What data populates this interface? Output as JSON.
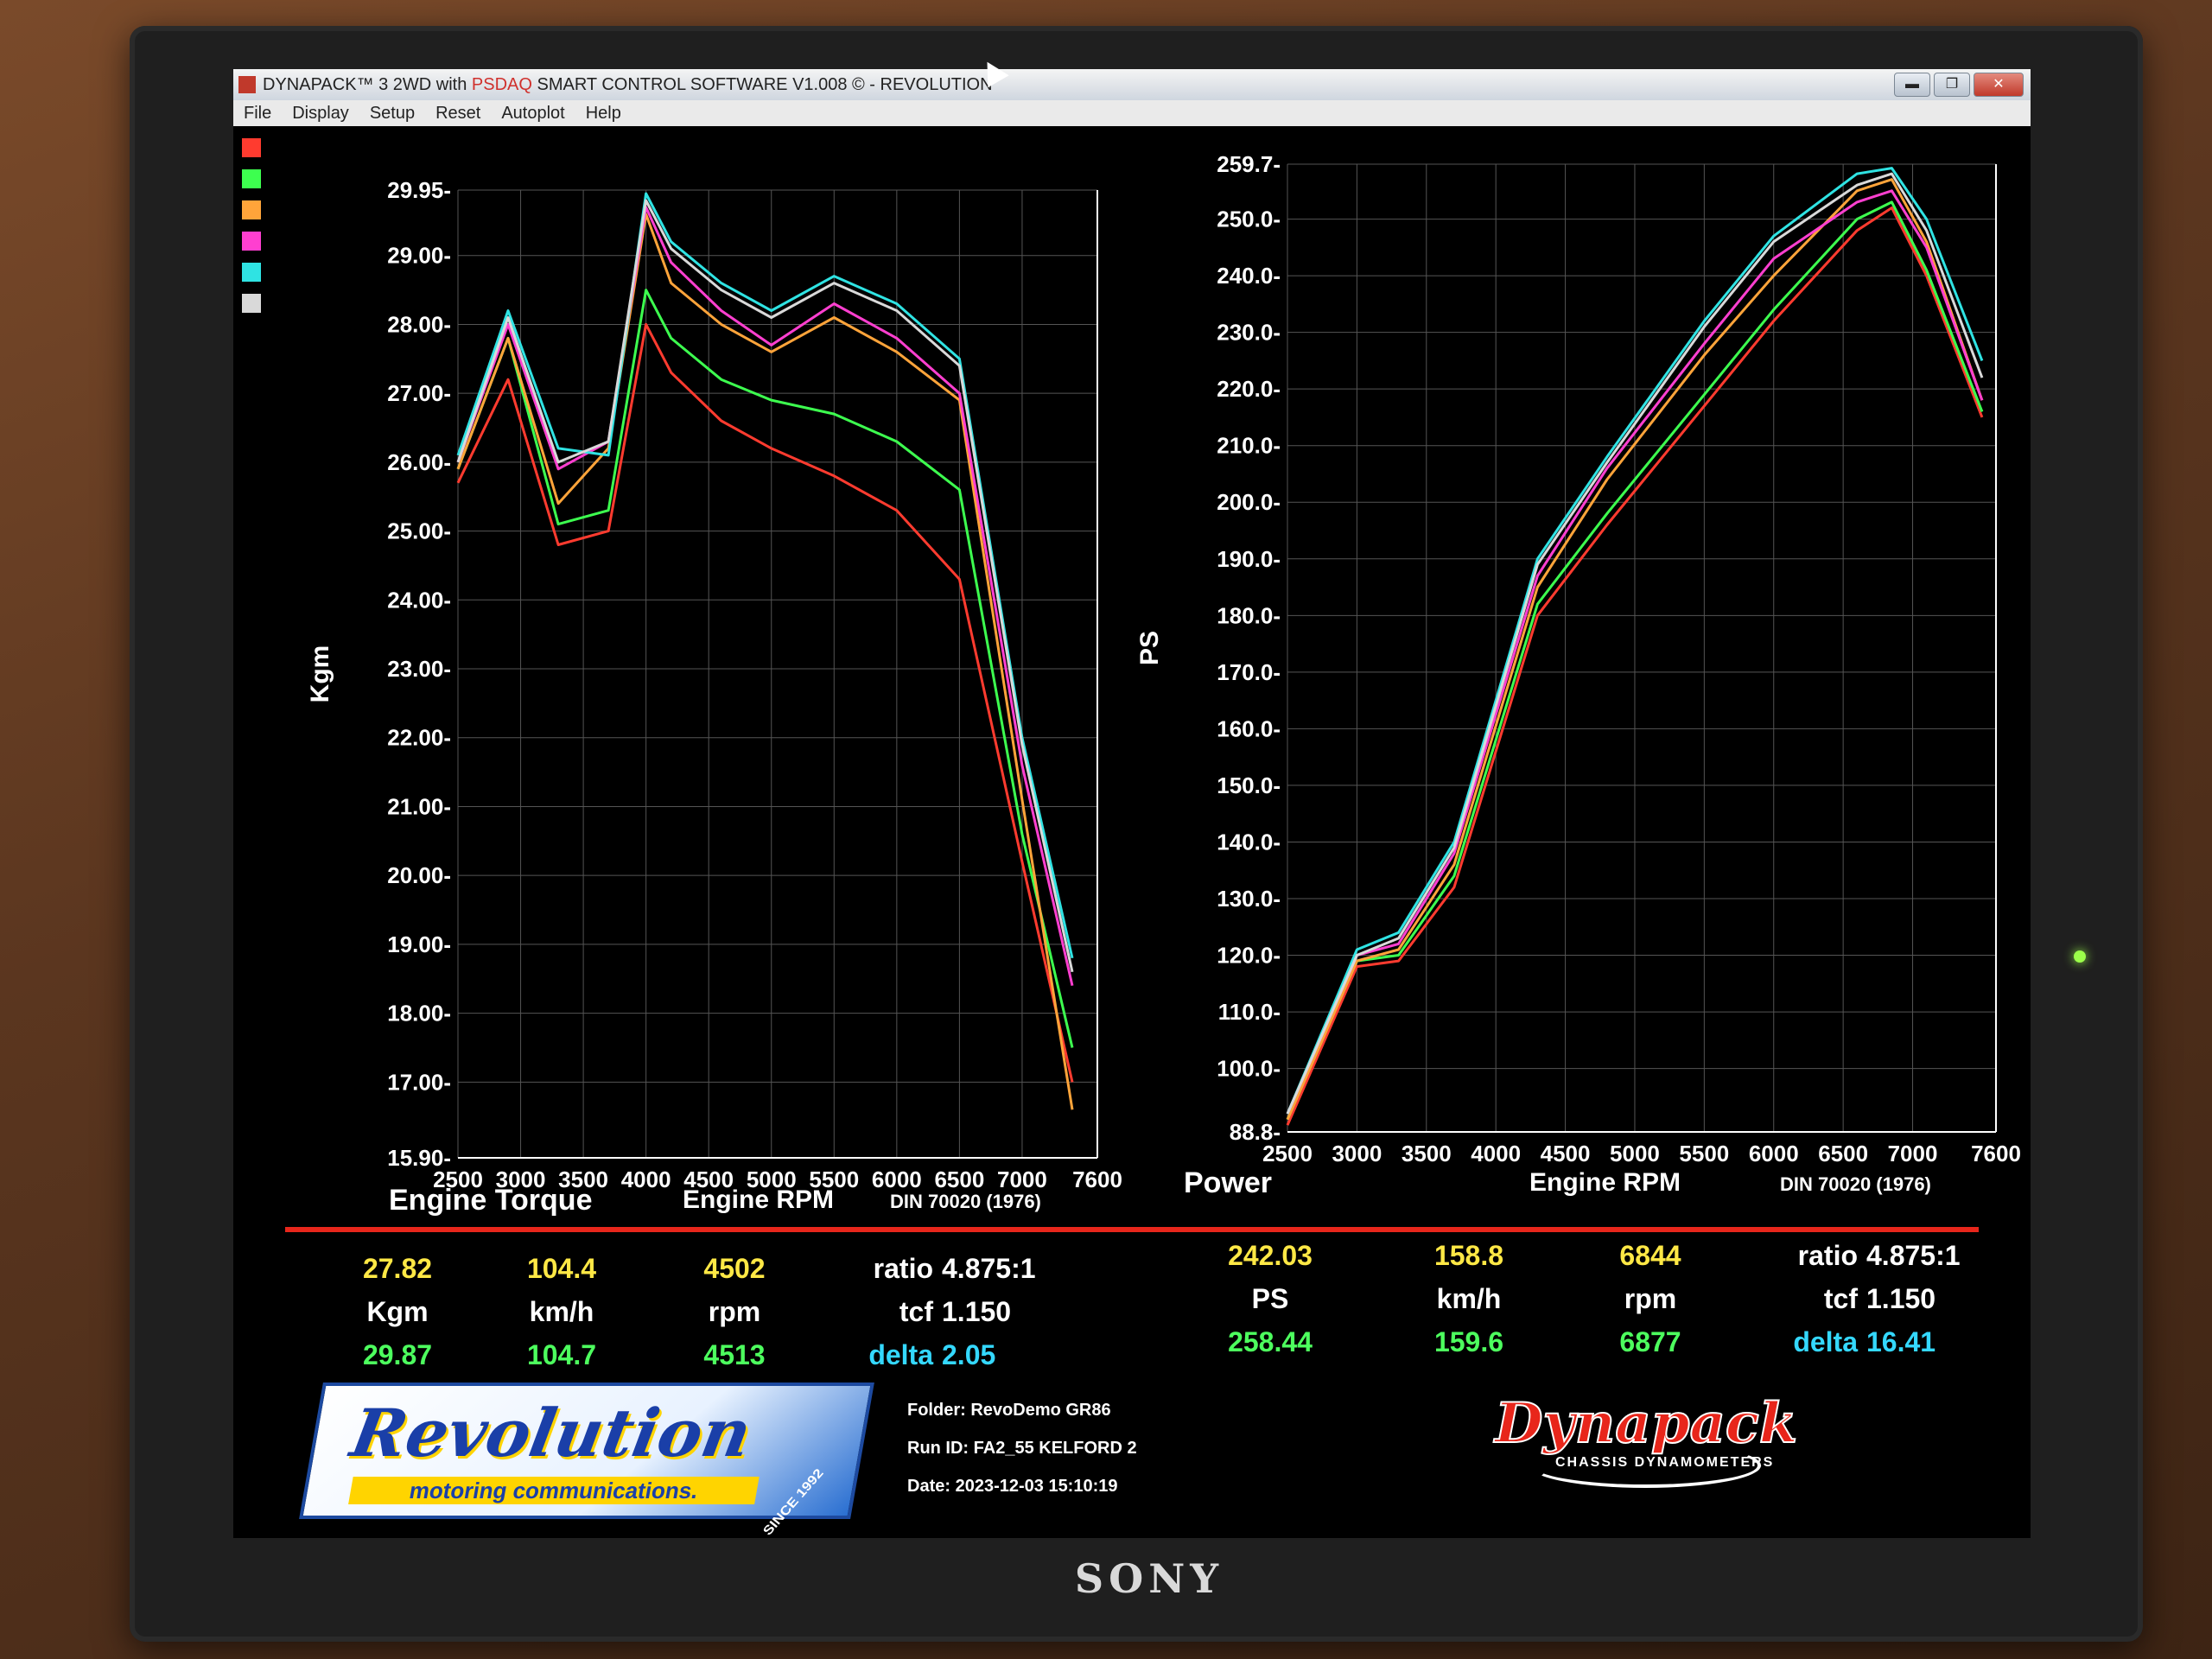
{
  "window": {
    "title_prefix": "DYNAPACK™ 3 2WD with ",
    "title_highlight": "PSDAQ",
    "title_suffix": " SMART CONTROL SOFTWARE V1.008 © - REVOLUTION",
    "min_label": "▬",
    "max_label": "❐",
    "close_label": "✕"
  },
  "menu": [
    "File",
    "Display",
    "Setup",
    "Reset",
    "Autoplot",
    "Help"
  ],
  "monitor_brand": "SONY",
  "colors": {
    "red": "#ff3b2f",
    "green": "#3dff4f",
    "orange": "#ffa43a",
    "magenta": "#ff3fd0",
    "cyan": "#2fe3e3",
    "white": "#d9d9d9",
    "yellow": "#ffe845"
  },
  "torque_panel": {
    "title": "Engine Torque",
    "x_label": "Engine RPM",
    "y_label": "Kgm",
    "std": "DIN 70020 (1976)"
  },
  "power_panel": {
    "title": "Power",
    "x_label": "Engine RPM",
    "y_label": "PS",
    "std": "DIN 70020 (1976)"
  },
  "torque_stats": {
    "val1": "27.82",
    "unit1": "Kgm",
    "peak1": "29.87",
    "val2": "104.4",
    "unit2": "km/h",
    "peak2": "104.7",
    "val3": "4502",
    "unit3": "rpm",
    "peak3": "4513",
    "ratio_label": "ratio",
    "ratio": "4.875:1",
    "tcf_label": "tcf",
    "tcf": "1.150",
    "delta_label": "delta",
    "delta": "2.05"
  },
  "power_stats": {
    "val1": "242.03",
    "unit1": "PS",
    "peak1": "258.44",
    "val2": "158.8",
    "unit2": "km/h",
    "peak2": "159.6",
    "val3": "6844",
    "unit3": "rpm",
    "peak3": "6877",
    "ratio_label": "ratio",
    "ratio": "4.875:1",
    "tcf_label": "tcf",
    "tcf": "1.150",
    "delta_label": "delta",
    "delta": "16.41"
  },
  "run_info": {
    "folder_label": "Folder:",
    "folder": "RevoDemo GR86",
    "run_label": "Run ID:",
    "run": "FA2_55 KELFORD 2",
    "date_label": "Date:",
    "date": "2023-12-03 15:10:19"
  },
  "logos": {
    "revolution": "Revolution",
    "revolution_sub": "motoring communications.",
    "revolution_since": "SINCE 1992",
    "dynapack": "Dynapack",
    "dynapack_sub": "CHASSIS DYNAMOMETERS"
  },
  "chart_data": [
    {
      "type": "line",
      "title": "Engine Torque",
      "xlabel": "Engine RPM",
      "ylabel": "Kgm",
      "xlim": [
        2500,
        7600
      ],
      "ylim": [
        15.9,
        29.95
      ],
      "xticks": [
        "2500",
        "3000",
        "3500",
        "4000",
        "4500",
        "5000",
        "5500",
        "6000",
        "6500",
        "7000",
        "7600"
      ],
      "yticks": [
        "15.90",
        "17.00",
        "18.00",
        "19.00",
        "20.00",
        "21.00",
        "22.00",
        "23.00",
        "24.00",
        "25.00",
        "26.00",
        "27.00",
        "28.00",
        "29.00",
        "29.95"
      ],
      "x": [
        2500,
        2900,
        3300,
        3700,
        4000,
        4200,
        4600,
        5000,
        5500,
        6000,
        6500,
        7000,
        7400
      ],
      "series": [
        {
          "color": "red",
          "values": [
            25.7,
            27.2,
            24.8,
            25.0,
            28.0,
            27.3,
            26.6,
            26.2,
            25.8,
            25.3,
            24.3,
            20.2,
            17.0
          ]
        },
        {
          "color": "green",
          "values": [
            25.9,
            27.8,
            25.1,
            25.3,
            28.5,
            27.8,
            27.2,
            26.9,
            26.7,
            26.3,
            25.6,
            20.6,
            17.5
          ]
        },
        {
          "color": "orange",
          "values": [
            25.9,
            27.8,
            25.4,
            26.2,
            29.6,
            28.6,
            28.0,
            27.6,
            28.1,
            27.6,
            26.9,
            21.1,
            16.6
          ]
        },
        {
          "color": "magenta",
          "values": [
            26.0,
            28.0,
            25.9,
            26.3,
            29.7,
            28.9,
            28.2,
            27.7,
            28.3,
            27.8,
            27.0,
            21.6,
            18.4
          ]
        },
        {
          "color": "cyan",
          "values": [
            26.1,
            28.2,
            26.2,
            26.1,
            29.9,
            29.2,
            28.6,
            28.2,
            28.7,
            28.3,
            27.5,
            22.0,
            18.8
          ]
        },
        {
          "color": "white",
          "values": [
            26.0,
            28.1,
            26.0,
            26.3,
            29.8,
            29.1,
            28.5,
            28.1,
            28.6,
            28.2,
            27.4,
            21.9,
            18.6
          ]
        }
      ]
    },
    {
      "type": "line",
      "title": "Power",
      "xlabel": "Engine RPM",
      "ylabel": "PS",
      "xlim": [
        2500,
        7600
      ],
      "ylim": [
        88.8,
        259.7
      ],
      "xticks": [
        "2500",
        "3000",
        "3500",
        "4000",
        "4500",
        "5000",
        "5500",
        "6000",
        "6500",
        "7000",
        "7600"
      ],
      "yticks": [
        "88.8",
        "100.0",
        "110.0",
        "120.0",
        "130.0",
        "140.0",
        "150.0",
        "160.0",
        "170.0",
        "180.0",
        "190.0",
        "200.0",
        "210.0",
        "220.0",
        "230.0",
        "240.0",
        "250.0",
        "259.7"
      ],
      "x": [
        2500,
        3000,
        3300,
        3700,
        4300,
        4800,
        5500,
        6000,
        6600,
        6850,
        7100,
        7500
      ],
      "series": [
        {
          "color": "red",
          "values": [
            90,
            118,
            119,
            132,
            180,
            196,
            217,
            232,
            248,
            252,
            240,
            215
          ]
        },
        {
          "color": "green",
          "values": [
            91,
            119,
            120,
            134,
            182,
            198,
            219,
            234,
            250,
            253,
            241,
            216
          ]
        },
        {
          "color": "orange",
          "values": [
            91,
            119,
            121,
            136,
            185,
            204,
            226,
            240,
            255,
            257,
            246,
            218
          ]
        },
        {
          "color": "magenta",
          "values": [
            92,
            120,
            122,
            138,
            187,
            206,
            228,
            243,
            253,
            255,
            245,
            218
          ]
        },
        {
          "color": "cyan",
          "values": [
            92,
            121,
            124,
            140,
            190,
            208,
            232,
            247,
            258,
            259,
            250,
            225
          ]
        },
        {
          "color": "white",
          "values": [
            92,
            120,
            123,
            139,
            189,
            207,
            231,
            246,
            256,
            258,
            248,
            222
          ]
        }
      ]
    }
  ]
}
